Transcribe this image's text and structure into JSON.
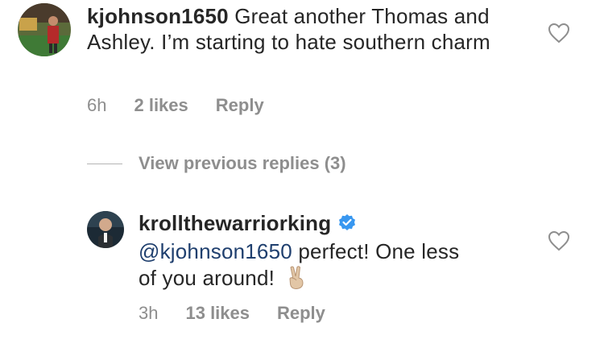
{
  "comment1": {
    "username": "kjohnson1650",
    "text": " Great another Thomas and Ashley. I’m starting to hate southern charm",
    "time": "6h",
    "likes": "2 likes",
    "reply_label": "Reply"
  },
  "view_replies": {
    "label": "View previous replies (3)"
  },
  "comment2": {
    "username": "krollthewarriorking",
    "mention": "@kjohnson1650",
    "text_line1": " perfect! One less",
    "text_line2": "of you around!",
    "time": "3h",
    "likes": "13 likes",
    "reply_label": "Reply"
  },
  "colors": {
    "text": "#262626",
    "secondary": "#8e8e8e",
    "mention": "#1f3f6e",
    "verified": "#3897f0"
  }
}
